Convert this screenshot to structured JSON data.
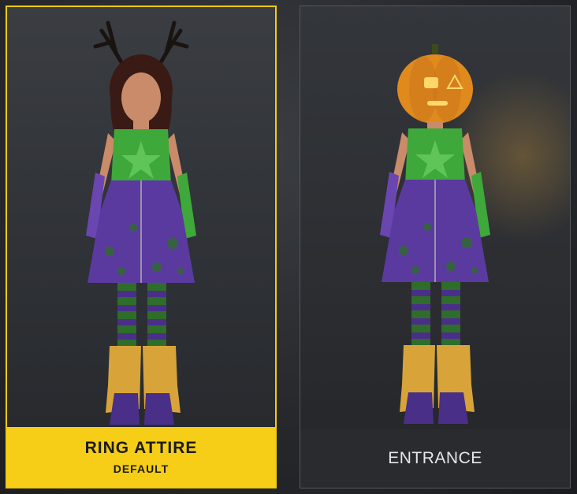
{
  "cards": [
    {
      "title": "RING ATTIRE",
      "subtitle": "DEFAULT",
      "selected": true,
      "headwear": "antlers"
    },
    {
      "title": "ENTRANCE",
      "subtitle": "",
      "selected": false,
      "headwear": "pumpkin-head"
    }
  ],
  "colors": {
    "accent": "#f6cd17",
    "outfit_top": "#3fa83a",
    "outfit_skirt": "#5b3aa0",
    "boot_fringe": "#d8a43a"
  }
}
